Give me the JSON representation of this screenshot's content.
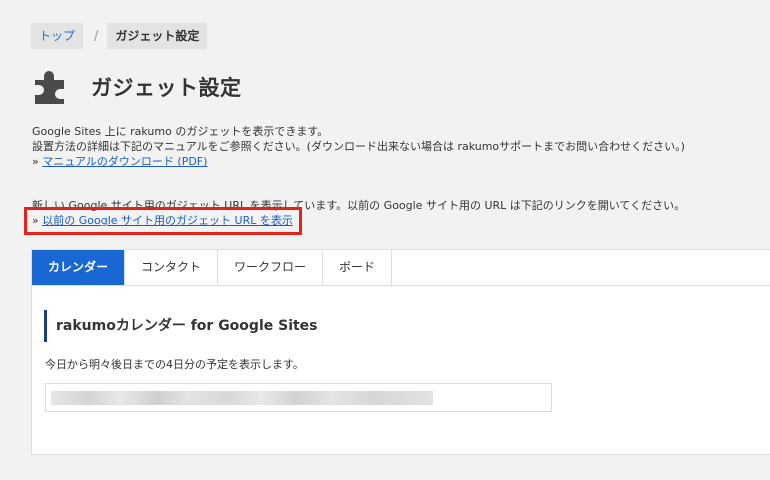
{
  "breadcrumb": {
    "home": "トップ",
    "separator": "/",
    "current": "ガジェット設定"
  },
  "header": {
    "icon": "puzzle-icon",
    "title": "ガジェット設定"
  },
  "description": {
    "line1": "Google Sites 上に rakumo のガジェットを表示できます。",
    "line2": "設置方法の詳細は下記のマニュアルをご参照ください。(ダウンロード出来ない場合は rakumoサポートまでお問い合わせください。)",
    "bullet": "»",
    "manual_link": "マニュアルのダウンロード (PDF)"
  },
  "notice": {
    "text": "新しい Google サイト用のガジェット URL を表示しています。以前の Google サイト用の URL は下記のリンクを開いてください。",
    "bullet": "»",
    "legacy_link": "以前の Google サイト用のガジェット URL を表示"
  },
  "tabs": [
    {
      "label": "カレンダー",
      "active": true
    },
    {
      "label": "コンタクト",
      "active": false
    },
    {
      "label": "ワークフロー",
      "active": false
    },
    {
      "label": "ボード",
      "active": false
    }
  ],
  "panel": {
    "title": "rakumoカレンダー for Google Sites",
    "description": "今日から明々後日までの4日分の予定を表示します。"
  },
  "colors": {
    "accent": "#1967d2",
    "highlight_border": "#e2231a",
    "link": "#1a5dbf"
  }
}
